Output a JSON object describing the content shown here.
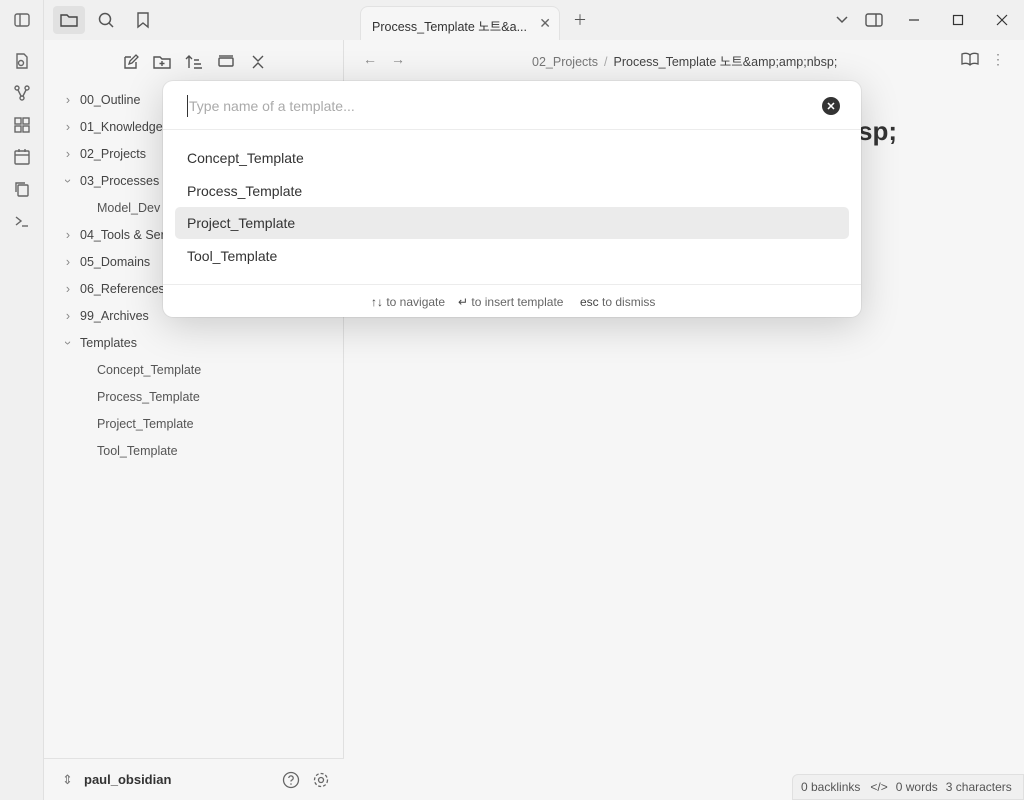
{
  "ribbon": {
    "icons": [
      "sidebar-toggle-icon",
      "note-icon",
      "graph-icon",
      "dashboard-icon",
      "calendar-icon",
      "copy-icon",
      "terminal-icon"
    ]
  },
  "left_top": {
    "icons": [
      "sidebar-icon",
      "folder-icon",
      "search-icon",
      "bookmark-icon"
    ]
  },
  "file_explorer": {
    "actions": [
      "new-note-icon",
      "new-folder-icon",
      "sort-icon",
      "collapse-icon",
      "close-icon"
    ],
    "items": [
      {
        "label": "00_Outline",
        "expanded": false
      },
      {
        "label": "01_Knowledge",
        "expanded": false
      },
      {
        "label": "02_Projects",
        "expanded": false
      },
      {
        "label": "03_Processes",
        "expanded": true
      },
      {
        "label": "Model_Dev",
        "child": true
      },
      {
        "label": "04_Tools & Ser",
        "expanded": false
      },
      {
        "label": "05_Domains",
        "expanded": false
      },
      {
        "label": "06_References",
        "expanded": false
      },
      {
        "label": "99_Archives",
        "expanded": false
      },
      {
        "label": "Templates",
        "expanded": true
      },
      {
        "label": "Concept_Template",
        "child": true
      },
      {
        "label": "Process_Template",
        "child": true
      },
      {
        "label": "Project_Template",
        "child": true
      },
      {
        "label": "Tool_Template",
        "child": true
      }
    ]
  },
  "vault": {
    "name": "paul_obsidian"
  },
  "tab": {
    "title": "Process_Template 노트&a..."
  },
  "breadcrumb": {
    "folder": "02_Projects",
    "separator": "/",
    "current": "Process_Template 노트&amp;amp;nbsp;"
  },
  "editor": {
    "title_fragment": "sp;"
  },
  "modal": {
    "placeholder": "Type name of a template...",
    "suggestions": [
      "Concept_Template",
      "Process_Template",
      "Project_Template",
      "Tool_Template"
    ],
    "selected_index": 2,
    "hints": [
      {
        "key": "↑↓",
        "text": "to navigate"
      },
      {
        "key": "↵",
        "text": "to insert template"
      },
      {
        "key": "esc",
        "text": "to dismiss"
      }
    ]
  },
  "status": {
    "backlinks": "0 backlinks",
    "words": "0 words",
    "characters": "3 characters"
  }
}
